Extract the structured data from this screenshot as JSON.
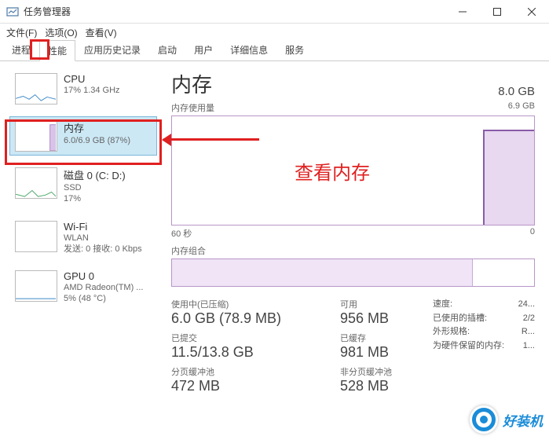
{
  "window": {
    "title": "任务管理器",
    "minimize": "—",
    "maximize": "□",
    "close": "×"
  },
  "menu": {
    "file": "文件(F)",
    "options": "选项(O)",
    "view": "查看(V)"
  },
  "tabs": {
    "processes": "进程",
    "performance": "性能",
    "app_history": "应用历史记录",
    "startup": "启动",
    "users": "用户",
    "details": "详细信息",
    "services": "服务"
  },
  "sidebar": {
    "cpu": {
      "title": "CPU",
      "sub": "17%  1.34 GHz"
    },
    "memory": {
      "title": "内存",
      "sub": "6.0/6.9 GB (87%)"
    },
    "disk": {
      "title": "磁盘 0 (C: D:)",
      "sub1": "SSD",
      "sub2": "17%"
    },
    "wifi": {
      "title": "Wi-Fi",
      "sub1": "WLAN",
      "sub2": "发送: 0 接收: 0 Kbps"
    },
    "gpu": {
      "title": "GPU 0",
      "sub1": "AMD Radeon(TM) ...",
      "sub2": "5% (48 °C)"
    }
  },
  "main": {
    "title": "内存",
    "total": "8.0 GB",
    "usage_label": "内存使用量",
    "usage_max": "6.9 GB",
    "axis_left": "60 秒",
    "axis_right": "0",
    "comp_label": "内存组合"
  },
  "stats": {
    "in_use_label": "使用中(已压缩)",
    "in_use_value": "6.0 GB  (78.9 MB)",
    "available_label": "可用",
    "available_value": "956 MB",
    "committed_label": "已提交",
    "committed_value": "11.5/13.8 GB",
    "cached_label": "已缓存",
    "cached_value": "981 MB",
    "paged_label": "分页缓冲池",
    "paged_value": "472 MB",
    "nonpaged_label": "非分页缓冲池",
    "nonpaged_value": "528 MB",
    "speed_label": "速度:",
    "speed_value": "24...",
    "slots_label": "已使用的插槽:",
    "slots_value": "2/2",
    "form_label": "外形规格:",
    "form_value": "R...",
    "reserved_label": "为硬件保留的内存:",
    "reserved_value": "1..."
  },
  "annotation": {
    "text": "查看内存"
  },
  "watermark": {
    "text": "好装机"
  },
  "chart_data": {
    "type": "area",
    "title": "内存使用量",
    "ylabel": "GB",
    "ylim": [
      0,
      6.9
    ],
    "x_range_seconds": [
      60,
      0
    ],
    "series": [
      {
        "name": "内存使用量",
        "approx_current_gb": 6.0,
        "note": "值在最右侧跃升至约 6.0 GB，此前区段无可见数据"
      }
    ]
  }
}
